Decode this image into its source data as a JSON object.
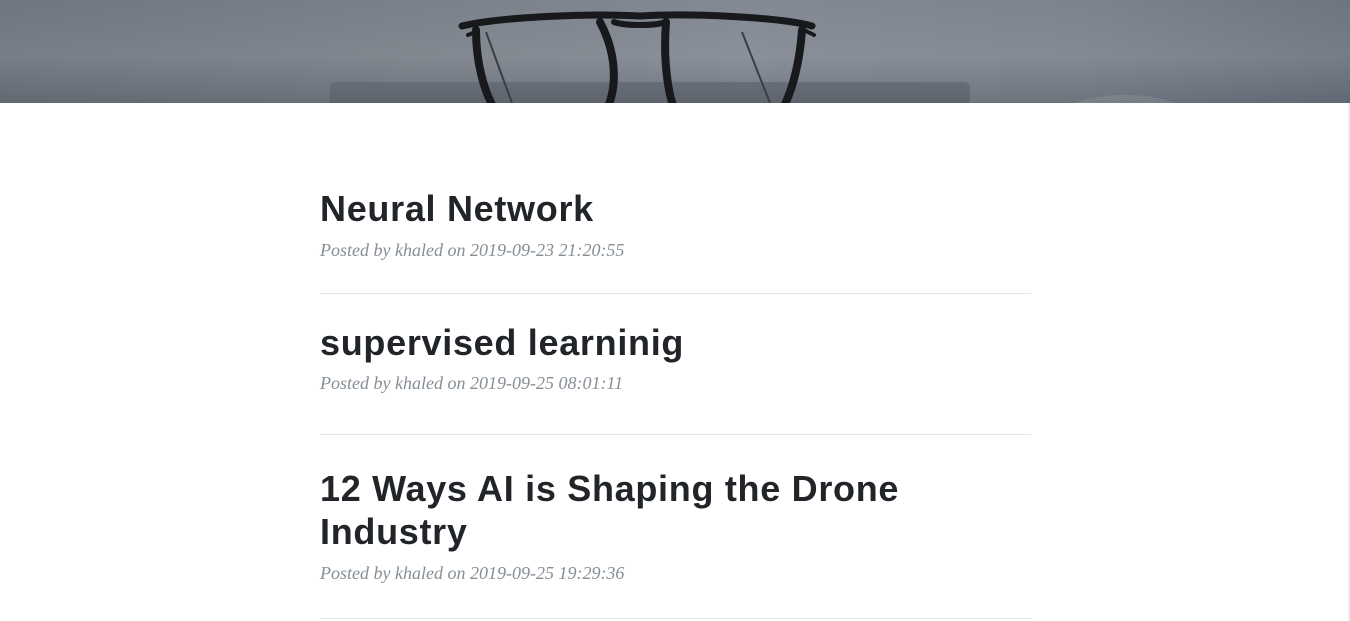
{
  "header": {
    "background_image": "glasses-on-laptop-image"
  },
  "posts": [
    {
      "title": "Neural Network",
      "meta": "Posted by khaled on 2019-09-23 21:20:55"
    },
    {
      "title": "supervised learninig",
      "meta": "Posted by khaled on 2019-09-25 08:01:11"
    },
    {
      "title": "12 Ways AI is Shaping the Drone Industry",
      "meta": "Posted by khaled on 2019-09-25 19:29:36"
    }
  ],
  "colors": {
    "title": "#212529",
    "meta": "#868e96",
    "divider": "#e3e3e3"
  }
}
